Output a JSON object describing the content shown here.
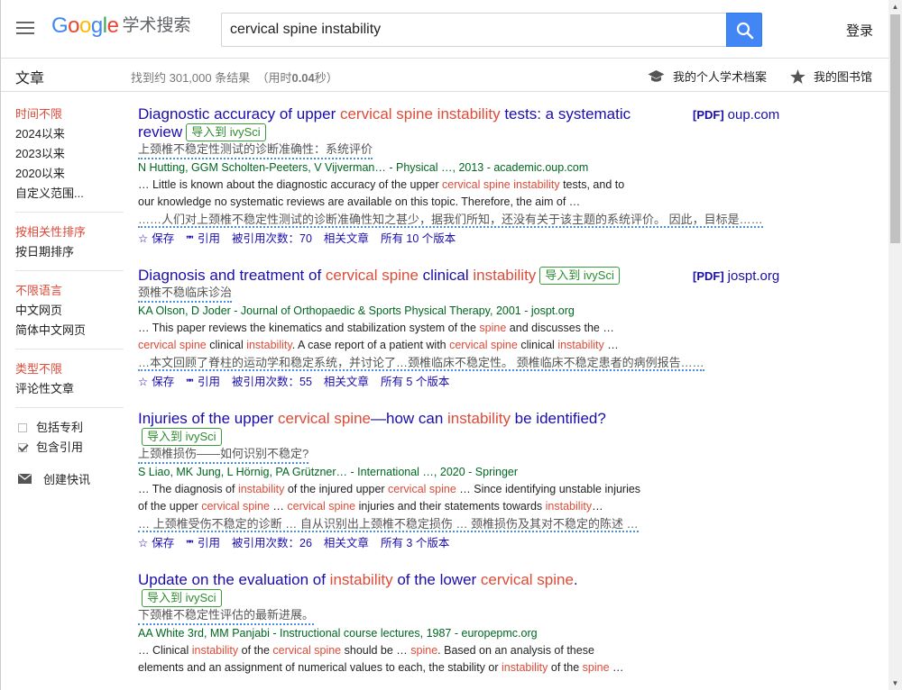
{
  "header": {
    "logo_text": "Google",
    "logo_colors": [
      "#4285f4",
      "#ea4335",
      "#fbbc05",
      "#4285f4",
      "#34a853",
      "#ea4335"
    ],
    "product_name": "学术搜索",
    "search_value": "cervical spine instability",
    "login_label": "登录"
  },
  "subheader": {
    "section": "文章",
    "stats_prefix": "找到约 301,000 条结果",
    "stats_time_prefix": "（用时",
    "stats_time": "0.04",
    "stats_time_suffix": "秒）",
    "profile_label": "我的个人学术档案",
    "library_label": "我的图书馆"
  },
  "sidebar": {
    "time": [
      "时间不限",
      "2024以来",
      "2023以来",
      "2020以来",
      "自定义范围..."
    ],
    "sort": [
      "按相关性排序",
      "按日期排序"
    ],
    "lang": [
      "不限语言",
      "中文网页",
      "简体中文网页"
    ],
    "type": [
      "类型不限",
      "评论性文章"
    ],
    "include_patents": "包括专利",
    "include_citations": "包含引用",
    "create_alert": "创建快讯"
  },
  "results": [
    {
      "title_parts": [
        [
          "Diagnostic accuracy of upper ",
          0
        ],
        [
          "cervical spine instability",
          1
        ],
        [
          " tests: a systematic review",
          0
        ]
      ],
      "ivy_label": "导入到 ivySci",
      "pdf_tag": "[PDF]",
      "pdf_source": "oup.com",
      "translation": "上颈椎不稳定性测试的诊断准确性：系统评价",
      "meta": "N Hutting, GGM Scholten-Peeters, V Vijverman… - Physical …, 2013 - academic.oup.com",
      "snippet_parts": [
        [
          "… Little is known about the diagnostic accuracy of the upper ",
          0
        ],
        [
          "cervical spine instability",
          1
        ],
        [
          " tests, and to our knowledge no systematic reviews are available on this topic. Therefore, the aim of …",
          0
        ]
      ],
      "snippet_translation": "……人们对上颈椎不稳定性测试的诊断准确性知之甚少，据我们所知，还没有关于该主题的系统评价。 因此，目标是……",
      "save": "保存",
      "cite": "引用",
      "cited_by": "被引用次数：70",
      "related": "相关文章",
      "versions": "所有 10 个版本"
    },
    {
      "title_parts": [
        [
          "Diagnosis and treatment of ",
          0
        ],
        [
          "cervical spine",
          1
        ],
        [
          " clinical ",
          0
        ],
        [
          "instability",
          1
        ]
      ],
      "ivy_label": "导入到 ivySci",
      "pdf_tag": "[PDF]",
      "pdf_source": "jospt.org",
      "translation": "颈椎不稳临床诊治",
      "meta": "KA Olson, D Joder - Journal of Orthopaedic & Sports Physical Therapy, 2001 - jospt.org",
      "snippet_parts": [
        [
          "… This paper reviews the kinematics and stabilization system of the ",
          0
        ],
        [
          "spine",
          1
        ],
        [
          " and discusses the … ",
          0
        ],
        [
          "cervical spine",
          1
        ],
        [
          " clinical ",
          0
        ],
        [
          "instability",
          1
        ],
        [
          ". A case report of a patient with ",
          0
        ],
        [
          "cervical spine",
          1
        ],
        [
          " clinical ",
          0
        ],
        [
          "instability",
          1
        ],
        [
          " …",
          0
        ]
      ],
      "snippet_translation": "…本文回顾了脊柱的运动学和稳定系统，并讨论了…颈椎临床不稳定性。 颈椎临床不稳定患者的病例报告……",
      "save": "保存",
      "cite": "引用",
      "cited_by": "被引用次数：55",
      "related": "相关文章",
      "versions": "所有 5 个版本"
    },
    {
      "title_parts": [
        [
          "Injuries of the upper ",
          0
        ],
        [
          "cervical spine",
          1
        ],
        [
          "—how can ",
          0
        ],
        [
          "instability",
          1
        ],
        [
          " be identified?",
          0
        ]
      ],
      "ivy_label": "导入到 ivySci",
      "pdf_tag": "",
      "pdf_source": "",
      "translation": "上颈椎损伤——如何识别不稳定?",
      "meta": "S Liao, MK Jung, L Hörnig, PA Grützner… - International …, 2020 - Springer",
      "snippet_parts": [
        [
          "… The diagnosis of ",
          0
        ],
        [
          "instability",
          1
        ],
        [
          " of the injured upper ",
          0
        ],
        [
          "cervical spine",
          1
        ],
        [
          " … Since identifying unstable injuries of the upper ",
          0
        ],
        [
          "cervical spine",
          1
        ],
        [
          " … ",
          0
        ],
        [
          "cervical spine",
          1
        ],
        [
          " injuries and their statements towards ",
          0
        ],
        [
          "instability",
          1
        ],
        [
          "…",
          0
        ]
      ],
      "snippet_translation": "… 上颈椎受伤不稳定的诊断 … 自从识别出上颈椎不稳定损伤 … 颈椎损伤及其对不稳定的陈述 …",
      "save": "保存",
      "cite": "引用",
      "cited_by": "被引用次数：26",
      "related": "相关文章",
      "versions": "所有 3 个版本"
    },
    {
      "title_parts": [
        [
          "Update on the evaluation of ",
          0
        ],
        [
          "instability",
          1
        ],
        [
          " of the lower ",
          0
        ],
        [
          "cervical spine",
          1
        ],
        [
          ".",
          0
        ]
      ],
      "ivy_label": "导入到 ivySci",
      "pdf_tag": "",
      "pdf_source": "",
      "translation": "下颈椎不稳定性评估的最新进展。",
      "meta": "AA White 3rd, MM Panjabi - Instructional course lectures, 1987 - europepmc.org",
      "snippet_parts": [
        [
          "… Clinical ",
          0
        ],
        [
          "instability",
          1
        ],
        [
          " of the ",
          0
        ],
        [
          "cervical spine",
          1
        ],
        [
          " should be … ",
          0
        ],
        [
          "spine",
          1
        ],
        [
          ". Based on an analysis of these elements and an assignment of numerical values to each, the stability or ",
          0
        ],
        [
          "instability",
          1
        ],
        [
          " of the ",
          0
        ],
        [
          "spine",
          1
        ],
        [
          " …",
          0
        ]
      ],
      "snippet_translation": "",
      "save": "",
      "cite": "",
      "cited_by": "",
      "related": "",
      "versions": ""
    }
  ]
}
